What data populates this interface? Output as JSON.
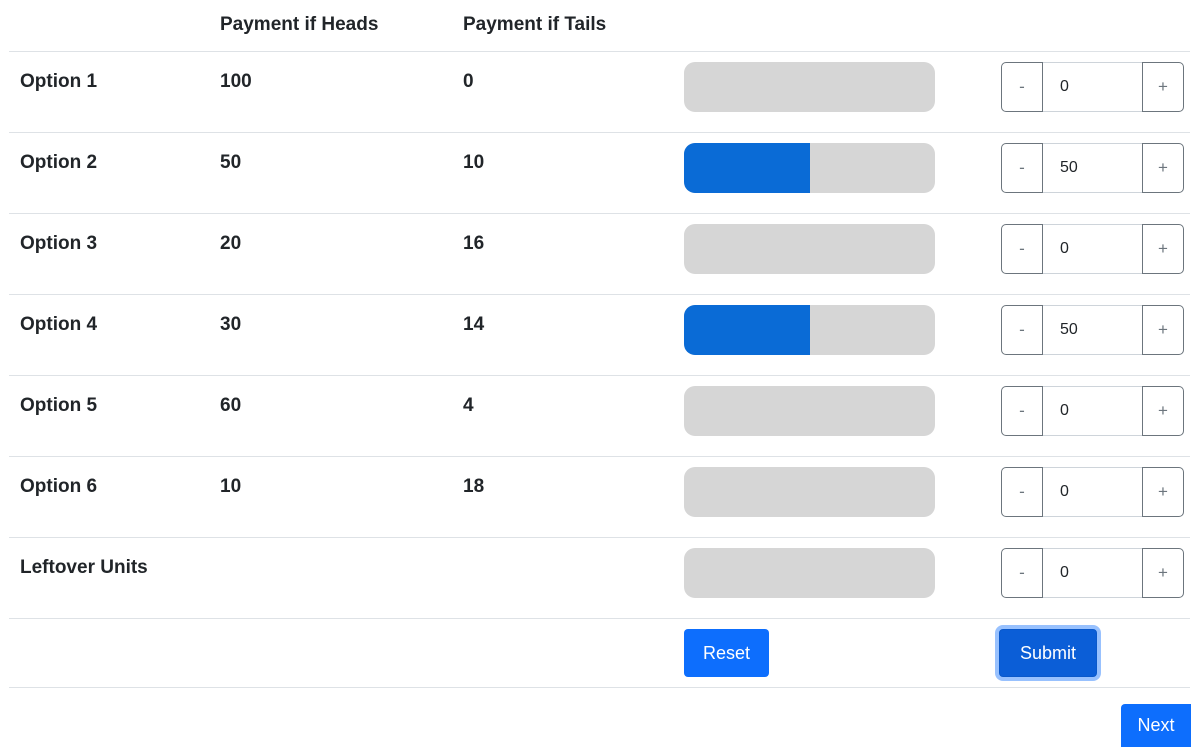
{
  "table": {
    "headers": {
      "label": "",
      "heads": "Payment if Heads",
      "tails": "Payment if Tails"
    },
    "rows": [
      {
        "label": "Option 1",
        "heads": "100",
        "tails": "0",
        "allocation": "0",
        "bar_fraction": 0.0
      },
      {
        "label": "Option 2",
        "heads": "50",
        "tails": "10",
        "allocation": "50",
        "bar_fraction": 0.5
      },
      {
        "label": "Option 3",
        "heads": "20",
        "tails": "16",
        "allocation": "0",
        "bar_fraction": 0.0
      },
      {
        "label": "Option 4",
        "heads": "30",
        "tails": "14",
        "allocation": "50",
        "bar_fraction": 0.5
      },
      {
        "label": "Option 5",
        "heads": "60",
        "tails": "4",
        "allocation": "0",
        "bar_fraction": 0.0
      },
      {
        "label": "Option 6",
        "heads": "10",
        "tails": "18",
        "allocation": "0",
        "bar_fraction": 0.0
      },
      {
        "label": "Leftover Units",
        "heads": "",
        "tails": "",
        "allocation": "0",
        "bar_fraction": 0.0
      }
    ]
  },
  "stepper": {
    "minus_label": "-",
    "plus_label": "+"
  },
  "actions": {
    "reset_label": "Reset",
    "submit_label": "Submit",
    "next_label": "Next"
  },
  "colors": {
    "bar_fill": "#0a6bd6",
    "bar_track": "#d6d6d6",
    "primary": "#0d6efd"
  }
}
